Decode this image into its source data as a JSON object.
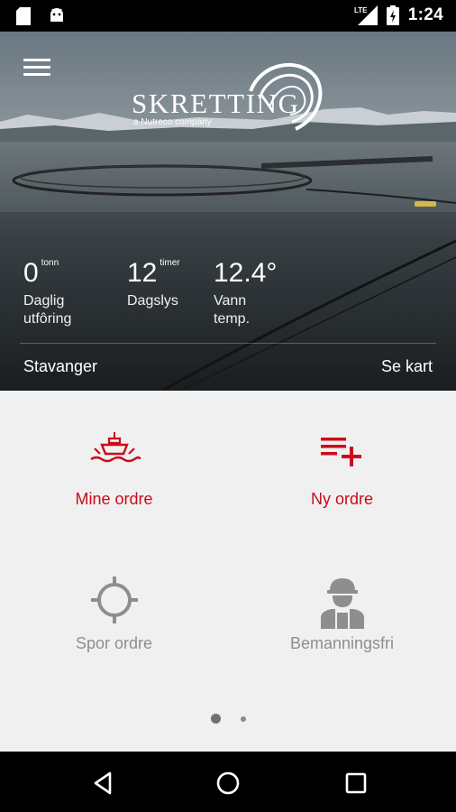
{
  "status_bar": {
    "time": "1:24",
    "network_label": "LTE",
    "icons": [
      "sd-card-icon",
      "android-icon",
      "signal-icon",
      "battery-charging-icon"
    ]
  },
  "header": {
    "logo_text": "SKRETTING",
    "logo_subtitle": "a Nutreco company",
    "menu_icon": "hamburger-menu-icon"
  },
  "stats": {
    "feeding": {
      "value": "0",
      "unit": "tonn",
      "label_line1": "Daglig",
      "label_line2": "utfôring"
    },
    "daylight": {
      "value": "12",
      "unit": "timer",
      "label_line1": "Dagslys",
      "label_line2": ""
    },
    "water": {
      "value": "12.4°",
      "unit": "",
      "label_line1": "Vann",
      "label_line2": "temp."
    }
  },
  "location": {
    "name": "Stavanger",
    "map_link": "Se kart"
  },
  "tiles": {
    "mine_orders": {
      "label": "Mine ordre",
      "icon": "ship-icon"
    },
    "new_order": {
      "label": "Ny ordre",
      "icon": "playlist-add-icon"
    },
    "track_order": {
      "label": "Spor ordre",
      "icon": "crosshair-icon"
    },
    "unmanned": {
      "label": "Bemanningsfri",
      "icon": "worker-icon"
    }
  },
  "pager": {
    "current_page": 1,
    "total_pages": 2
  },
  "colors": {
    "accent": "#cc0a18",
    "inactive": "#8e8e8e",
    "background": "#f0f0f0"
  }
}
